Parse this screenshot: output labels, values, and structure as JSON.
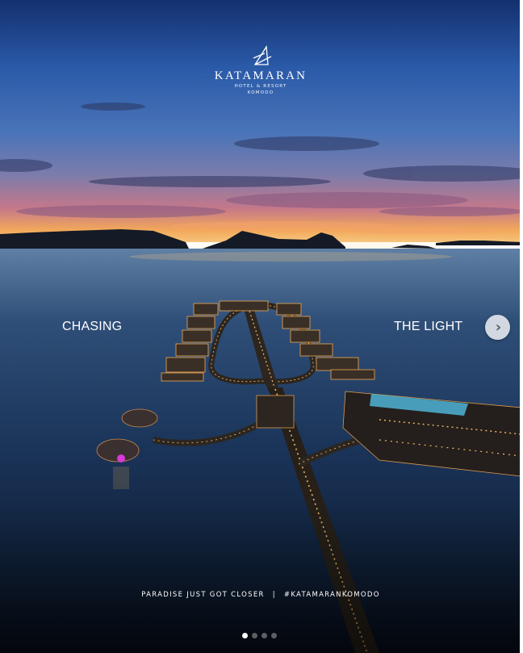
{
  "logo": {
    "name": "KATAMARAN",
    "line1": "HOTEL & RESORT",
    "line2": "KOMODO",
    "icon": "sail-boat-icon"
  },
  "headline": {
    "left": "CHASING",
    "right": "THE LIGHT"
  },
  "caption": {
    "text": "PARADISE JUST GOT CLOSER",
    "separator": "|",
    "hashtag": "#KATAMARANKOMODO"
  },
  "carousel": {
    "next_icon": "chevron-right-icon",
    "slide_count": 4,
    "active_index": 0
  },
  "colors": {
    "sky_top": "#14306f",
    "sunset": "#f2a85a",
    "water": "#0f2540",
    "lights": "#ffb347",
    "accent_light": "#d83ad8"
  }
}
